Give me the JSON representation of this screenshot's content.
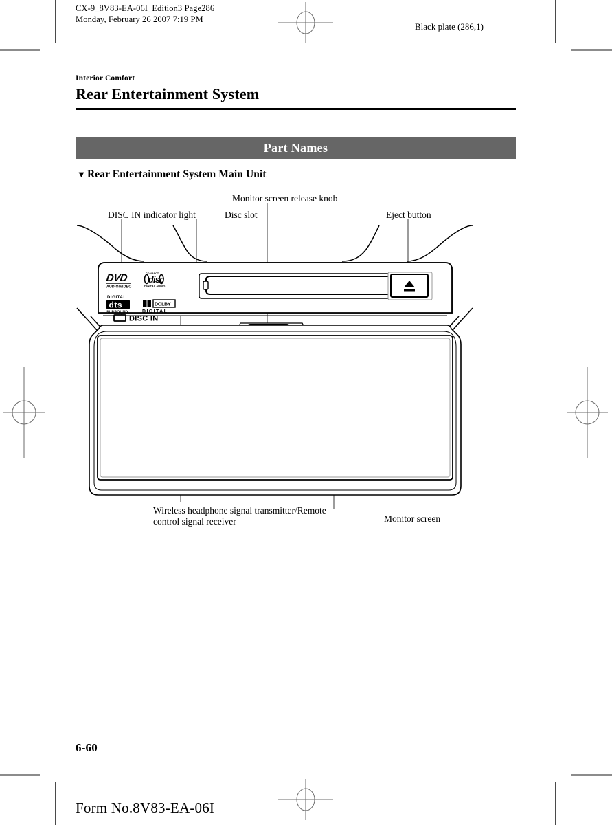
{
  "header": {
    "file_line1": "CX-9_8V83-EA-06I_Edition3 Page286",
    "file_line2": "Monday, February 26 2007 7:19 PM",
    "plate_info": "Black plate (286,1)"
  },
  "chapter": "Interior Comfort",
  "page_title": "Rear Entertainment System",
  "section": {
    "bar_title": "Part Names",
    "subsection_marker": "▼",
    "subsection_title": "Rear Entertainment System Main Unit"
  },
  "callouts": {
    "disc_in_indicator": "DISC IN indicator light",
    "disc_slot": "Disc slot",
    "monitor_release_knob": "Monitor screen release knob",
    "eject_button": "Eject button",
    "wireless_transmitter_line1": "Wireless headphone signal transmitter/Remote",
    "wireless_transmitter_line2": "control signal receiver",
    "monitor_screen": "Monitor screen"
  },
  "device_markings": {
    "dvd_logo_main": "DVD",
    "dvd_logo_sub": "AUDIO/VIDEO",
    "cd_logo_top": "COMPACT",
    "cd_logo_main": "disc",
    "cd_logo_sub": "DIGITAL AUDIO",
    "dts_logo_top": "DIGITAL",
    "dts_logo_main": "dts",
    "dts_logo_sub": "SURROUND",
    "dolby_logo_main": "DOLBY",
    "dolby_logo_sub": "D I G I T A L",
    "disc_in_label": "DISC IN",
    "eject_icon": "eject-triangle"
  },
  "footer": {
    "page_number": "6-60",
    "form_number": "Form No.8V83-EA-06I"
  },
  "colors": {
    "section_bar_bg": "#666666",
    "section_bar_fg": "#ffffff",
    "rule": "#000000",
    "crop_mark": "#8c8c8c",
    "ink": "#000000"
  }
}
